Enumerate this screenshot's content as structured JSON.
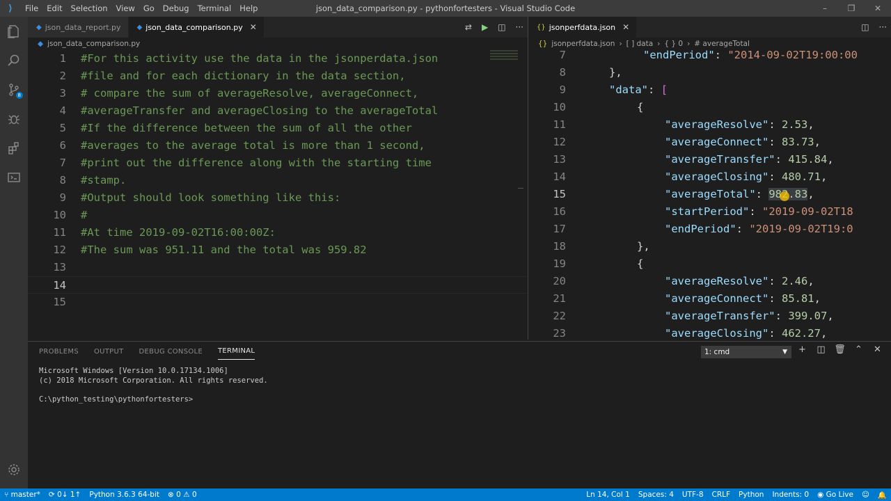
{
  "titlebar": {
    "menu": [
      "File",
      "Edit",
      "Selection",
      "View",
      "Go",
      "Debug",
      "Terminal",
      "Help"
    ],
    "title": "json_data_comparison.py - pythonfortesters - Visual Studio Code",
    "controls": [
      "–",
      "❐",
      "✕"
    ]
  },
  "activity": {
    "badge": "8"
  },
  "editor1": {
    "tabs": [
      {
        "label": "json_data_report.py"
      },
      {
        "label": "json_data_comparison.py"
      }
    ],
    "breadcrumb": "json_data_comparison.py",
    "lines": [
      {
        "n": "1",
        "t": "#For this activity use the data in the jsonperdata.json"
      },
      {
        "n": "2",
        "t": "#file and for each dictionary in the data section,"
      },
      {
        "n": "3",
        "t": "# compare the sum of averageResolve, averageConnect,"
      },
      {
        "n": "4",
        "t": "#averageTransfer and averageClosing to the averageTotal"
      },
      {
        "n": "5",
        "t": "#If the difference between the sum of all the other"
      },
      {
        "n": "6",
        "t": "#averages to the average total is more than 1 second,"
      },
      {
        "n": "7",
        "t": "#print out the difference along with the starting time"
      },
      {
        "n": "8",
        "t": "#stamp."
      },
      {
        "n": "9",
        "t": "#Output should look something like this:"
      },
      {
        "n": "10",
        "t": "#"
      },
      {
        "n": "11",
        "t": "#At time 2019-09-02T16:00:00Z:"
      },
      {
        "n": "12",
        "t": "#The sum was 951.11 and the total was 959.82"
      },
      {
        "n": "13",
        "t": ""
      },
      {
        "n": "14",
        "t": ""
      },
      {
        "n": "15",
        "t": ""
      }
    ]
  },
  "editor2": {
    "tab": "jsonperfdata.json",
    "breadcrumb": [
      "jsonperfdata.json",
      "›",
      "[ ] data",
      "›",
      "{ } 0",
      "›",
      "# averageTotal"
    ],
    "lines": {
      "l7": {
        "n": "7",
        "k": "\"endPeriod\"",
        "v": "\"2014-09-02T19:00:00"
      },
      "l8": {
        "n": "8",
        "t": "},"
      },
      "l9": {
        "n": "9",
        "k": "\"data\"",
        "v": "["
      },
      "l10": {
        "n": "10",
        "t": "{"
      },
      "l11": {
        "n": "11",
        "k": "\"averageResolve\"",
        "v": "2.53"
      },
      "l12": {
        "n": "12",
        "k": "\"averageConnect\"",
        "v": "83.73"
      },
      "l13": {
        "n": "13",
        "k": "\"averageTransfer\"",
        "v": "415.84"
      },
      "l14": {
        "n": "14",
        "k": "\"averageClosing\"",
        "v": "480.71"
      },
      "l15": {
        "n": "15",
        "k": "\"averageTotal\"",
        "v": "982.83"
      },
      "l16": {
        "n": "16",
        "k": "\"startPeriod\"",
        "v": "\"2019-09-02T18"
      },
      "l17": {
        "n": "17",
        "k": "\"endPeriod\"",
        "v": "\"2019-09-02T19:0"
      },
      "l18": {
        "n": "18",
        "t": "},"
      },
      "l19": {
        "n": "19",
        "t": "{"
      },
      "l20": {
        "n": "20",
        "k": "\"averageResolve\"",
        "v": "2.46"
      },
      "l21": {
        "n": "21",
        "k": "\"averageConnect\"",
        "v": "85.81"
      },
      "l22": {
        "n": "22",
        "k": "\"averageTransfer\"",
        "v": "399.07"
      },
      "l23": {
        "n": "23",
        "k": "\"averageClosing\"",
        "v": "462.27"
      }
    }
  },
  "panel": {
    "tabs": [
      "PROBLEMS",
      "OUTPUT",
      "DEBUG CONSOLE",
      "TERMINAL"
    ],
    "terminal_select": "1: cmd",
    "terminal_lines": [
      "Microsoft Windows [Version 10.0.17134.1006]",
      "(c) 2018 Microsoft Corporation. All rights reserved.",
      "",
      "C:\\python_testing\\pythonfortesters>"
    ]
  },
  "status": {
    "branch": "master*",
    "sync": "0↓ 1↑",
    "python": "Python 3.6.3 64-bit",
    "errors": "0",
    "warnings": "0",
    "position": "Ln 14, Col 1",
    "spaces": "Spaces: 4",
    "encoding": "UTF-8",
    "eol": "CRLF",
    "language": "Python",
    "indents": "Indents: 0",
    "golive": "Go Live"
  },
  "colors": {
    "accent": "#007acc",
    "comment": "#6a9955",
    "json_key": "#9cdcfe",
    "json_string": "#ce9178",
    "json_number": "#b5cea8"
  }
}
